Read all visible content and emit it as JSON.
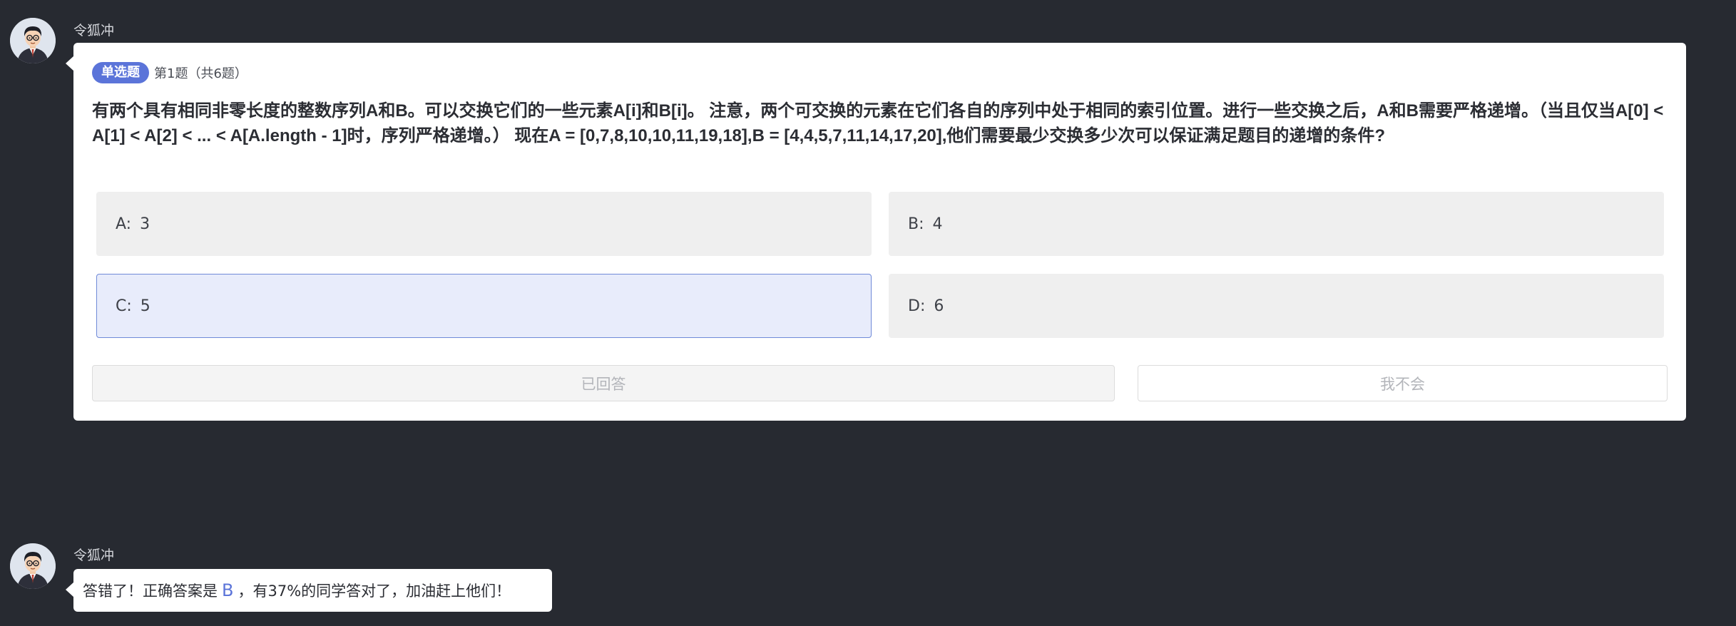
{
  "messages": [
    {
      "sender": "令狐冲",
      "quiz": {
        "type_badge": "单选题",
        "progress": "第1题（共6题）",
        "question": "有两个具有相同非零长度的整数序列A和B。可以交换它们的一些元素A[i]和B[i]。 注意，两个可交换的元素在它们各自的序列中处于相同的索引位置。进行一些交换之后，A和B需要严格递增。（当且仅当A[0] < A[1] < A[2] < ... < A[A.length - 1]时，序列严格递增。） 现在A = [0,7,8,10,10,11,19,18],B = [4,4,5,7,11,14,17,20],他们需要最少交换多少次可以保证满足题目的递增的条件?",
        "options": [
          {
            "letter": "A:",
            "value": "3",
            "selected": false
          },
          {
            "letter": "B:",
            "value": "4",
            "selected": false
          },
          {
            "letter": "C:",
            "value": "5",
            "selected": true
          },
          {
            "letter": "D:",
            "value": "6",
            "selected": false
          }
        ],
        "answered_label": "已回答",
        "dont_know_label": "我不会"
      }
    },
    {
      "sender": "令狐冲",
      "result": {
        "prefix": "答错了！正确答案是",
        "correct_answer": "B",
        "suffix": "，有37%的同学答对了，加油赶上他们！"
      }
    }
  ],
  "colors": {
    "background": "#272a31",
    "accent": "#5b74d9",
    "selected_option_bg": "#e8ecfb"
  },
  "icons": {
    "avatar": "cartoon-man-with-glasses-avatar"
  }
}
